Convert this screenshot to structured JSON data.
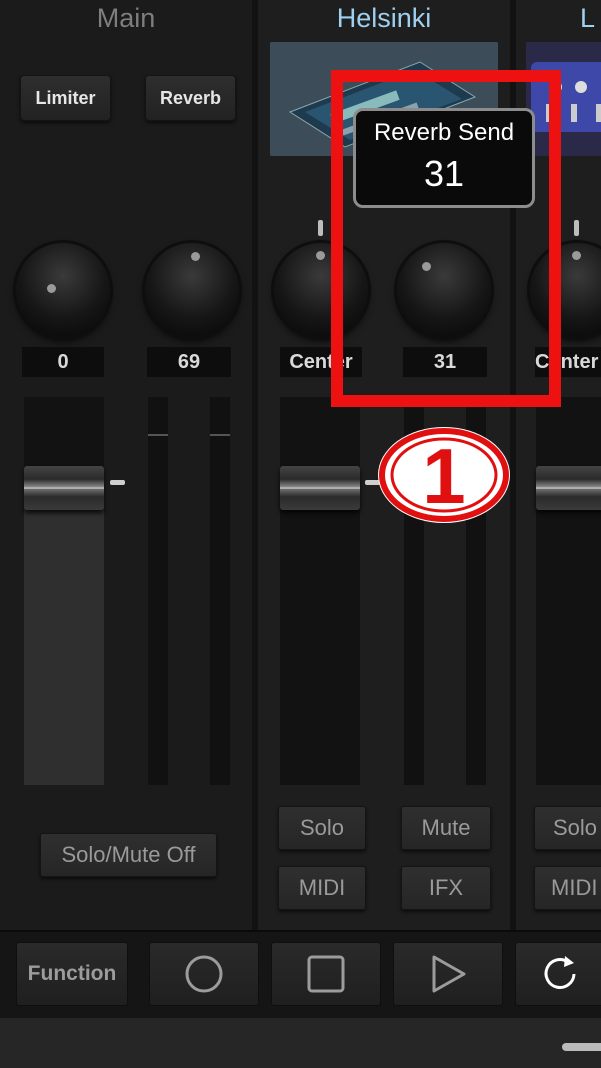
{
  "channels": {
    "main": {
      "name": "Main",
      "buttons": [
        "Limiter",
        "Reverb"
      ],
      "knob_values": [
        "0",
        "69"
      ],
      "solo_mute_off": "Solo/Mute Off"
    },
    "helsinki": {
      "name": "Helsinki",
      "pan_value": "Center",
      "send_value": "31",
      "buttons": {
        "solo": "Solo",
        "mute": "Mute",
        "midi": "MIDI",
        "ifx": "IFX"
      }
    },
    "third": {
      "name": "L",
      "pan_value": "Center",
      "buttons": {
        "solo": "Solo",
        "midi": "MIDI"
      }
    }
  },
  "popup": {
    "label": "Reverb Send",
    "value": "31"
  },
  "annotation": {
    "badge_number": "1",
    "highlight_color": "#ee1111"
  },
  "transport": {
    "function_label": "Function",
    "icons": [
      "record-icon",
      "stop-icon",
      "play-icon",
      "loop-icon"
    ]
  },
  "colors": {
    "channel_name_active": "#9fd0f0",
    "channel_name_main": "#7e7e7e"
  }
}
